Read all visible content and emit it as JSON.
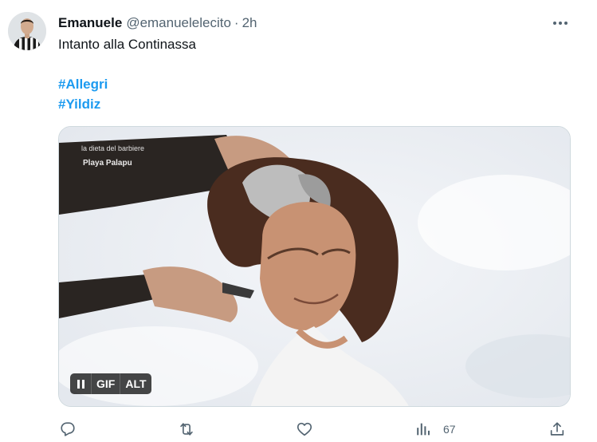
{
  "tweet": {
    "author_name": "Emanuele",
    "author_handle": "@emanuelelecito",
    "separator": "·",
    "time": "2h",
    "text": "Intanto alla Continassa",
    "hashtags": [
      "#Allegri",
      "#Yildiz"
    ]
  },
  "media": {
    "overlay_line1": "la dieta del barbiere",
    "overlay_line2": "Playa Palapu",
    "badges": {
      "gif": "GIF",
      "alt": "ALT"
    }
  },
  "actions": {
    "reply_icon": "reply-icon",
    "retweet_icon": "retweet-icon",
    "like_icon": "heart-icon",
    "views_icon": "views-icon",
    "views_count": "67",
    "share_icon": "share-icon"
  },
  "colors": {
    "accent": "#1d9bf0",
    "secondary_text": "#536471",
    "primary_text": "#0f1419"
  }
}
